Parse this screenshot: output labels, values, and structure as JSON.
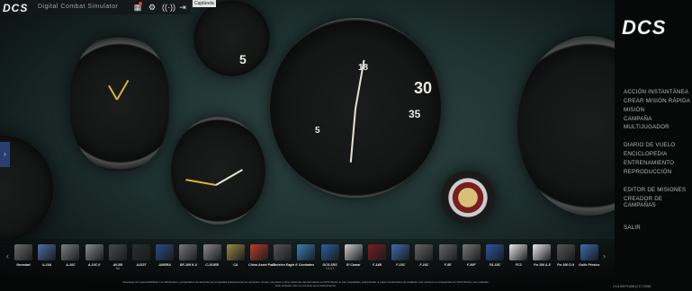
{
  "topbar": {
    "logo": "DCS",
    "brand_text": "Digital Combat Simulator",
    "tooltip": "Captúrela"
  },
  "right_logo": "DCS",
  "menu": {
    "items": [
      "ACCIÓN INSTANTÁNEA",
      "CREAR MISIÓN RÁPIDA",
      "MISIÓN",
      "CAMPAÑA",
      "MULTIJUGADOR",
      "DIARIO DE VUELO",
      "ENCICLOPEDIA",
      "ENTRENAMIENTO",
      "REPRODUCCIÓN",
      "EDITOR DE MISIONES",
      "CREADOR DE CAMPAÑAS",
      "SALIR"
    ]
  },
  "modules": [
    {
      "name": "Novedad",
      "sub": "",
      "color": "#6b6b6b"
    },
    {
      "name": "A-10A",
      "sub": "",
      "color": "#4b6fa8"
    },
    {
      "name": "A-10C",
      "sub": "",
      "color": "#7a7f7f"
    },
    {
      "name": "A-10C II",
      "sub": "",
      "color": "#858a8a"
    },
    {
      "name": "AV-8B",
      "sub": "NA",
      "color": "#444a4a"
    },
    {
      "name": "AJS37",
      "sub": "",
      "color": "#2b2e2e"
    },
    {
      "name": "AVIBRA",
      "sub": "",
      "color": "#2a4c8a"
    },
    {
      "name": "BF-109 K-4",
      "sub": "",
      "color": "#777"
    },
    {
      "name": "C-101EB",
      "sub": "",
      "color": "#888"
    },
    {
      "name": "CA",
      "sub": "",
      "color": "#9a8a4a"
    },
    {
      "name": "China Asset Pack",
      "sub": "",
      "color": "#c0392b"
    },
    {
      "name": "Christen Eagle II",
      "sub": "",
      "color": "#555"
    },
    {
      "name": "Combates",
      "sub": "",
      "color": "#3b7fb8"
    },
    {
      "name": "DCS-SRS",
      "sub": "1.0.0.1",
      "color": "#2b5fa0"
    },
    {
      "name": "El Camar",
      "sub": "",
      "color": "#ccc"
    },
    {
      "name": "F-14B",
      "sub": "",
      "color": "#7a1e1e"
    },
    {
      "name": "F-15C",
      "sub": "",
      "color": "#3b6bb0"
    },
    {
      "name": "F-16C",
      "sub": "",
      "color": "#666"
    },
    {
      "name": "F-5E",
      "sub": "",
      "color": "#666"
    },
    {
      "name": "F-86F",
      "sub": "",
      "color": "#777"
    },
    {
      "name": "FA-18C",
      "sub": "",
      "color": "#2a55a8"
    },
    {
      "name": "FC3",
      "sub": "",
      "color": "#e8e8e8"
    },
    {
      "name": "Fw 190 A-8",
      "sub": "",
      "color": "#eaeaea"
    },
    {
      "name": "Fw 190 D-9",
      "sub": "",
      "color": "#555"
    },
    {
      "name": "Golfo Pérsico",
      "sub": "",
      "color": "#3b6bb0"
    }
  ],
  "disclaimer": {
    "line1": "Descargo de responsabilidad: Los fabricantes y propietarios de derechos de propiedad intelectual de los vehículos, armas, sensores y otros sistemas representados en DCS World no han respaldado, patrocinado ni están involucrados de cualquier otra manera en el desarrollo de DCS World y sus módulos.",
    "line2": "Este software sólo se usa fines de entretenimiento."
  },
  "version": "2.5.6.50979.A5M (2.5.7.0000)",
  "colors": {
    "accent": "#2a3f70",
    "badge": "#e23b3b"
  }
}
